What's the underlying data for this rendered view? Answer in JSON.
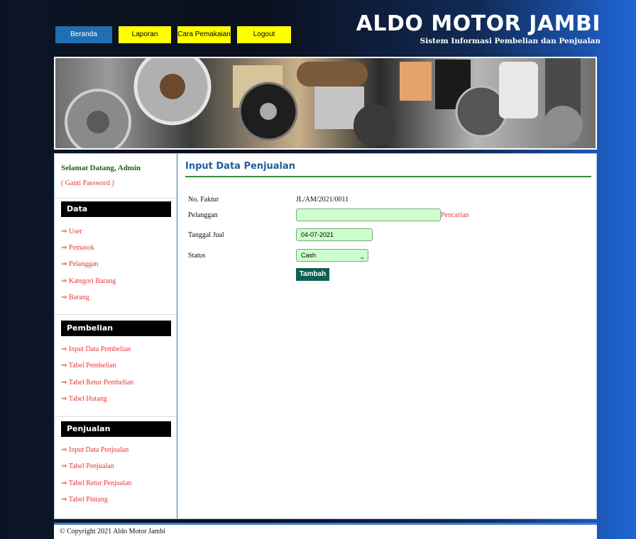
{
  "nav": {
    "items": [
      {
        "label": "Beranda",
        "active": true
      },
      {
        "label": "Laporan",
        "active": false
      },
      {
        "label": "Cara Pemakaian",
        "active": false
      },
      {
        "label": "Logout",
        "active": false
      }
    ]
  },
  "brand": {
    "title": "ALDO MOTOR JAMBI",
    "subtitle": "Sistem Informasi Pembelian dan Penjualan"
  },
  "sidebar": {
    "welcome": "Selamat Datang, Admin",
    "change_password": "( Ganti Password )",
    "sections": [
      {
        "title": "Data",
        "links": [
          "⇒ User",
          "⇒ Pemasok",
          "⇒ Pelanggan",
          "⇒ Kategori Barang",
          "⇒ Barang"
        ]
      },
      {
        "title": "Pembelian",
        "links": [
          "⇒ Input Data Pembelian",
          "⇒ Tabel Pembelian",
          "⇒ Tabel Retur Pembelian",
          "⇒ Tabel Hutang"
        ]
      },
      {
        "title": "Penjualan",
        "links": [
          "⇒ Input Data Penjualan",
          "⇒ Tabel Penjualan",
          "⇒ Tabel Retur Penjualan",
          "⇒ Tabel Piutang"
        ]
      }
    ]
  },
  "main": {
    "title": "Input Data Penjualan",
    "form": {
      "no_faktur_label": "No. Faktur",
      "no_faktur_value": "JL/AM/2021/0011",
      "pelanggan_label": "Pelanggan",
      "pelanggan_value": "",
      "pencarian_label": "Pencarian",
      "tanggal_label": "Tanggal Jual",
      "tanggal_value": "04-07-2021",
      "status_label": "Status",
      "status_value": "Cash",
      "submit_label": "Tambah"
    }
  },
  "footer": {
    "text": "© Copyright 2021 Aldo Motor Jambi"
  },
  "colors": {
    "nav_active": "#1f6fb2",
    "nav_button": "#ffff00",
    "link": "#e53935",
    "title": "#215e9c",
    "input_bg": "#ccffcc",
    "submit_bg": "#0e5f52"
  }
}
